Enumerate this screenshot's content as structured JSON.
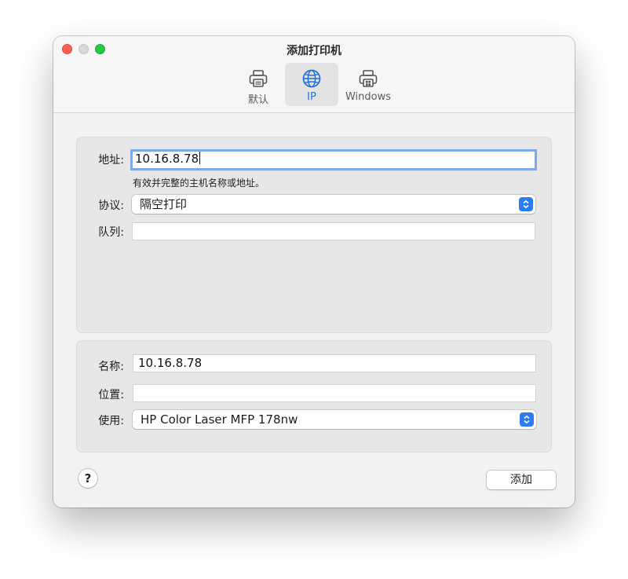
{
  "window": {
    "title": "添加打印机"
  },
  "toolbar": {
    "tabs": [
      {
        "label": "默认",
        "icon": "printer-icon"
      },
      {
        "label": "IP",
        "icon": "globe-icon"
      },
      {
        "label": "Windows",
        "icon": "windows-printer-icon"
      }
    ],
    "selected": "IP"
  },
  "connection": {
    "address_label": "地址:",
    "address_value": "10.16.8.78",
    "address_hint": "有效并完整的主机名称或地址。",
    "protocol_label": "协议:",
    "protocol_value": "隔空打印",
    "queue_label": "队列:",
    "queue_value": ""
  },
  "details": {
    "name_label": "名称:",
    "name_value": "10.16.8.78",
    "location_label": "位置:",
    "location_value": "",
    "use_label": "使用:",
    "use_value": "HP Color Laser MFP 178nw"
  },
  "footer": {
    "help_label": "?",
    "add_label": "添加"
  },
  "colors": {
    "accent": "#2b7cf6",
    "focus_ring": "#7fa9ee"
  }
}
